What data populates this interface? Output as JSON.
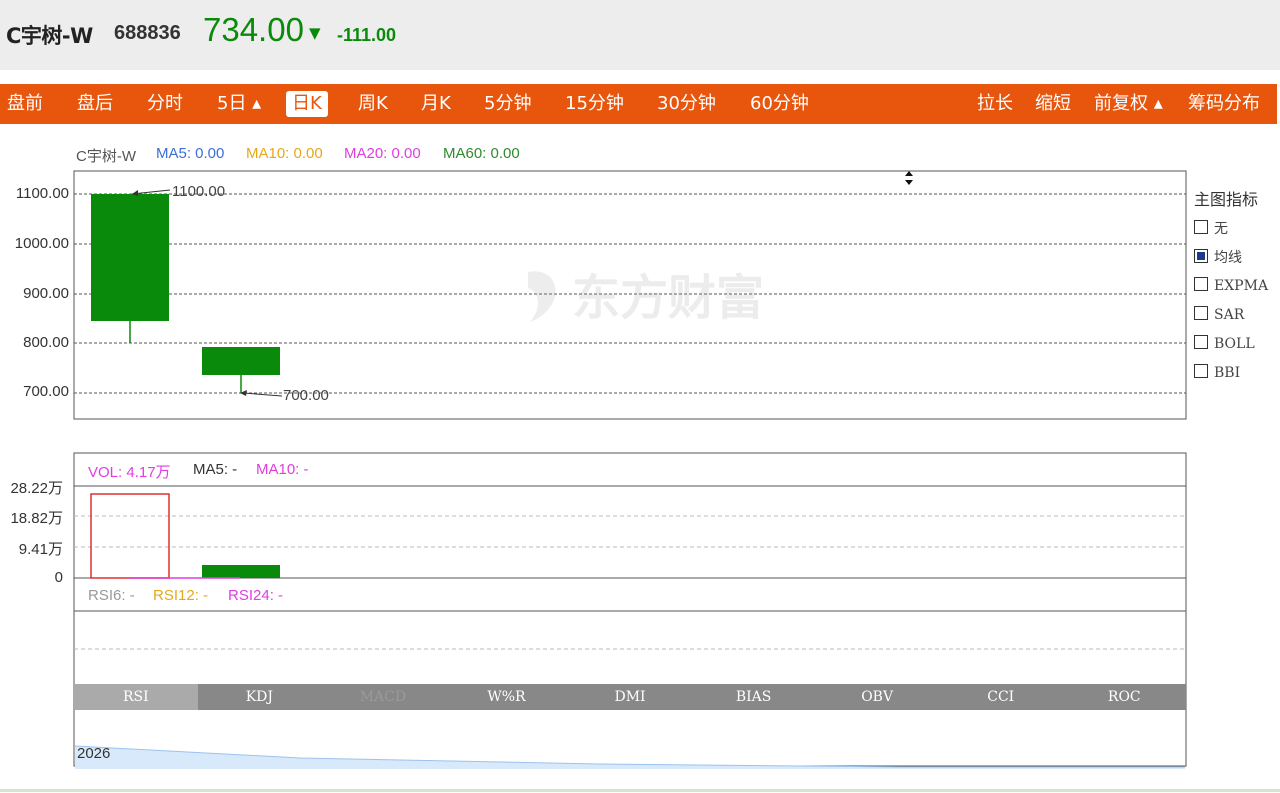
{
  "stock": {
    "name": "C宇树-W",
    "code": "688836",
    "price": "734.00",
    "change": "-111.00",
    "trend_icon": "down-triangle-icon",
    "color": "#0a8a0a"
  },
  "tabs": [
    {
      "label": "盘前"
    },
    {
      "label": "盘后"
    },
    {
      "label": "分时"
    },
    {
      "label": "5日 ▴"
    },
    {
      "label": "日K",
      "active": true
    },
    {
      "label": "周K"
    },
    {
      "label": "月K"
    },
    {
      "label": "5分钟"
    },
    {
      "label": "15分钟"
    },
    {
      "label": "30分钟"
    },
    {
      "label": "60分钟"
    }
  ],
  "right_tabs": [
    {
      "label": "拉长"
    },
    {
      "label": "缩短"
    },
    {
      "label": "前复权 ▴"
    },
    {
      "label": "筹码分布"
    }
  ],
  "main_legend": {
    "name": "C宇树-W",
    "ma5": "MA5: 0.00",
    "ma10": "MA10: 0.00",
    "ma20": "MA20: 0.00",
    "ma60": "MA60: 0.00"
  },
  "watermark": "东方财富",
  "indicators": {
    "title": "主图指标",
    "options": [
      {
        "label": "无",
        "checked": false
      },
      {
        "label": "均线",
        "checked": true
      },
      {
        "label": "EXPMA",
        "checked": false
      },
      {
        "label": "SAR",
        "checked": false
      },
      {
        "label": "BOLL",
        "checked": false
      },
      {
        "label": "BBI",
        "checked": false
      }
    ]
  },
  "vol_legend": {
    "vol": "VOL: 4.17万",
    "ma5": "MA5: -",
    "ma10": "MA10: -"
  },
  "rsi_legend": {
    "rsi6": "RSI6: -",
    "rsi12": "RSI12: -",
    "rsi24": "RSI24: -"
  },
  "indicator_tabs": [
    {
      "label": "RSI",
      "active": true
    },
    {
      "label": "KDJ"
    },
    {
      "label": "MACD",
      "dim": true
    },
    {
      "label": "W%R"
    },
    {
      "label": "DMI"
    },
    {
      "label": "BIAS"
    },
    {
      "label": "OBV"
    },
    {
      "label": "CCI"
    },
    {
      "label": "ROC"
    }
  ],
  "navigator": {
    "year": "2026"
  },
  "chart_data": [
    {
      "type": "candlestick",
      "yticks": [
        "1100.00",
        "1000.00",
        "900.00",
        "800.00",
        "700.00"
      ],
      "ylim": [
        700,
        1100
      ],
      "candles": [
        {
          "open": 1100,
          "close": 845,
          "high": 1100,
          "low": 800,
          "color": "#0a8a0a"
        },
        {
          "open": 793,
          "close": 734,
          "high": 793,
          "low": 700,
          "color": "#0a8a0a"
        }
      ],
      "annotations": [
        {
          "text": "1100.00",
          "value": 1100
        },
        {
          "text": "700.00",
          "value": 700
        }
      ],
      "grid": true
    },
    {
      "type": "bar",
      "title": "VOL",
      "yticks": [
        "28.22万",
        "18.82万",
        "9.41万",
        "0"
      ],
      "values_wan": [
        28.22,
        4.17
      ],
      "colors": [
        "#e03131",
        "#0a8a0a"
      ],
      "hollow": [
        true,
        false
      ],
      "grid": true
    }
  ]
}
